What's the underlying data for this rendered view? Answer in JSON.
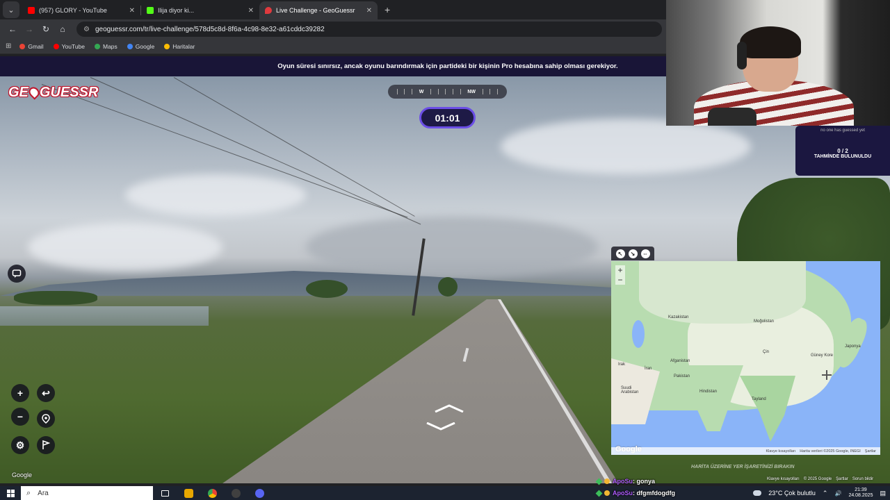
{
  "browser": {
    "tabs": [
      {
        "title": "(957) GLORY - YouTube",
        "favicon_color": "#ff0000",
        "active": false
      },
      {
        "title": "Ilija diyor ki...",
        "favicon_color": "#53fc18",
        "active": false
      },
      {
        "title": "Live Challenge - GeoGuessr",
        "favicon_color": "#e03a3e",
        "active": true
      }
    ],
    "close_glyph": "✕",
    "new_tab_glyph": "+",
    "url": "geoguessr.com/tr/live-challenge/578d5c8d-8f6a-4c98-8e32-a61cddc39282",
    "bookmarks": [
      {
        "label": "Gmail",
        "color": "#ea4335"
      },
      {
        "label": "YouTube",
        "color": "#ff0000"
      },
      {
        "label": "Maps",
        "color": "#34a853"
      },
      {
        "label": "Google",
        "color": "#4285f4"
      },
      {
        "label": "Haritalar",
        "color": "#fbbc04"
      }
    ]
  },
  "game": {
    "banner": "Oyun süresi sınırsız, ancak oyunu barındırmak için partideki bir kişinin Pro hesabına sahip olması gerekiyor.",
    "logo_left": "GE",
    "logo_right": "GUESSR",
    "compass": {
      "left": "W",
      "right": "NW"
    },
    "timer": "01:01",
    "status": {
      "no_guess": "no one has guessed yet",
      "count": "0 / 2",
      "label": "TAHMİNDE BULUNULDU"
    },
    "streetview_watermark": "Google",
    "map": {
      "labels": [
        {
          "text": "Kazakistan",
          "name": "map-label-kazakhstan"
        },
        {
          "text": "Moğolistan",
          "name": "map-label-mongolia"
        },
        {
          "text": "Afganistan",
          "name": "map-label-afghanistan"
        },
        {
          "text": "İran",
          "name": "map-label-iran"
        },
        {
          "text": "Irak",
          "name": "map-label-iraq"
        },
        {
          "text": "Pakistan",
          "name": "map-label-pakistan"
        },
        {
          "text": "Çin",
          "name": "map-label-china"
        },
        {
          "text": "Güney Kore",
          "name": "map-label-south-korea"
        },
        {
          "text": "Japonya",
          "name": "map-label-japan"
        },
        {
          "text": "Suudi Arabistan",
          "name": "map-label-saudi-arabia"
        },
        {
          "text": "Hindistan",
          "name": "map-label-india"
        },
        {
          "text": "Tayland",
          "name": "map-label-thailand"
        }
      ],
      "footer": [
        "Klavye kısayolları",
        "Harita verileri ©2025 Google, INEGI",
        "Şartlar"
      ],
      "google": "Google",
      "hint": "HARİTA ÜZERİNE YER İŞARETİNİZİ BIRAKIN"
    },
    "sv_footer": [
      "Klavye kısayolları",
      "© 2025 Google",
      "Şartlar",
      "Sorun bildir"
    ]
  },
  "chat": [
    {
      "user": "ApoSu",
      "message": ": gonya"
    },
    {
      "user": "ApoSu",
      "message": ": dfgmfdogdfg"
    }
  ],
  "taskbar": {
    "search_placeholder": "Ara",
    "weather": "23°C  Çok bulutlu",
    "time": "21:39",
    "date": "24.08.2025",
    "tray_chevron": "⌃",
    "volume_icon": "🔊",
    "notifications_icon": "▤",
    "pinned_colors": [
      "#e8a700",
      "#ffb900",
      "#4285f4",
      "#404040",
      "#5865f2"
    ]
  }
}
